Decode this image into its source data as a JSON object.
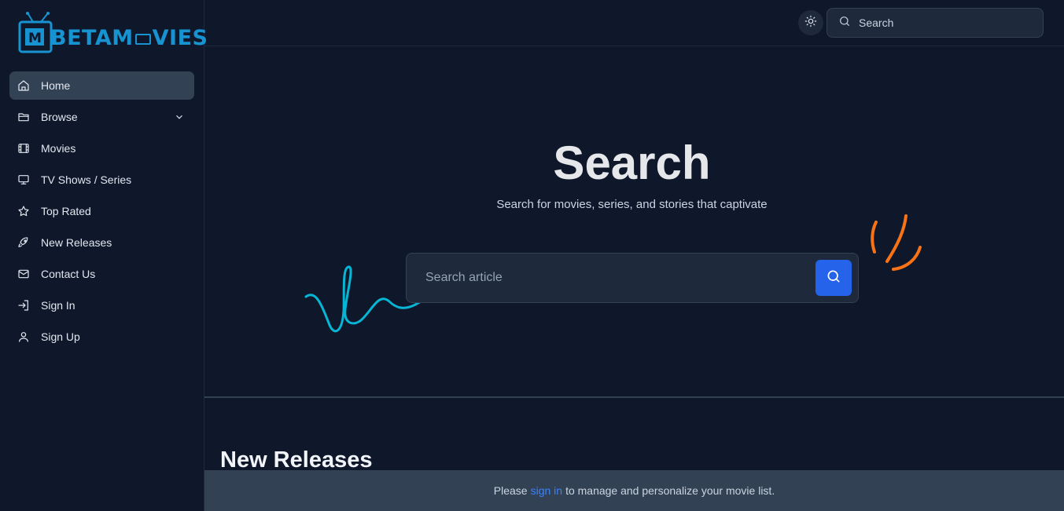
{
  "brand": {
    "name_part1": "BETA",
    "name_part2": "M",
    "name_part3": "VIES",
    "color": "#1793d1"
  },
  "sidebar": {
    "items": [
      {
        "label": "Home",
        "icon": "home-icon",
        "active": true
      },
      {
        "label": "Browse",
        "icon": "folder-icon",
        "has_children": true
      },
      {
        "label": "Movies",
        "icon": "film-icon"
      },
      {
        "label": "TV Shows / Series",
        "icon": "monitor-icon"
      },
      {
        "label": "Top Rated",
        "icon": "star-icon"
      },
      {
        "label": "New Releases",
        "icon": "rocket-icon"
      },
      {
        "label": "Contact Us",
        "icon": "mail-icon"
      },
      {
        "label": "Sign In",
        "icon": "sign-in-icon"
      },
      {
        "label": "Sign Up",
        "icon": "user-icon"
      }
    ]
  },
  "header": {
    "search_placeholder": "Search",
    "theme_icon": "sun-icon"
  },
  "hero": {
    "title": "Search",
    "subtitle": "Search for movies, series, and stories that captivate",
    "search_placeholder": "Search article",
    "button_icon": "search-icon",
    "accent_color": "#2563eb"
  },
  "section": {
    "title": "New Releases"
  },
  "banner": {
    "prefix": "Please",
    "link": "sign in",
    "suffix": "to manage and personalize your movie list."
  }
}
